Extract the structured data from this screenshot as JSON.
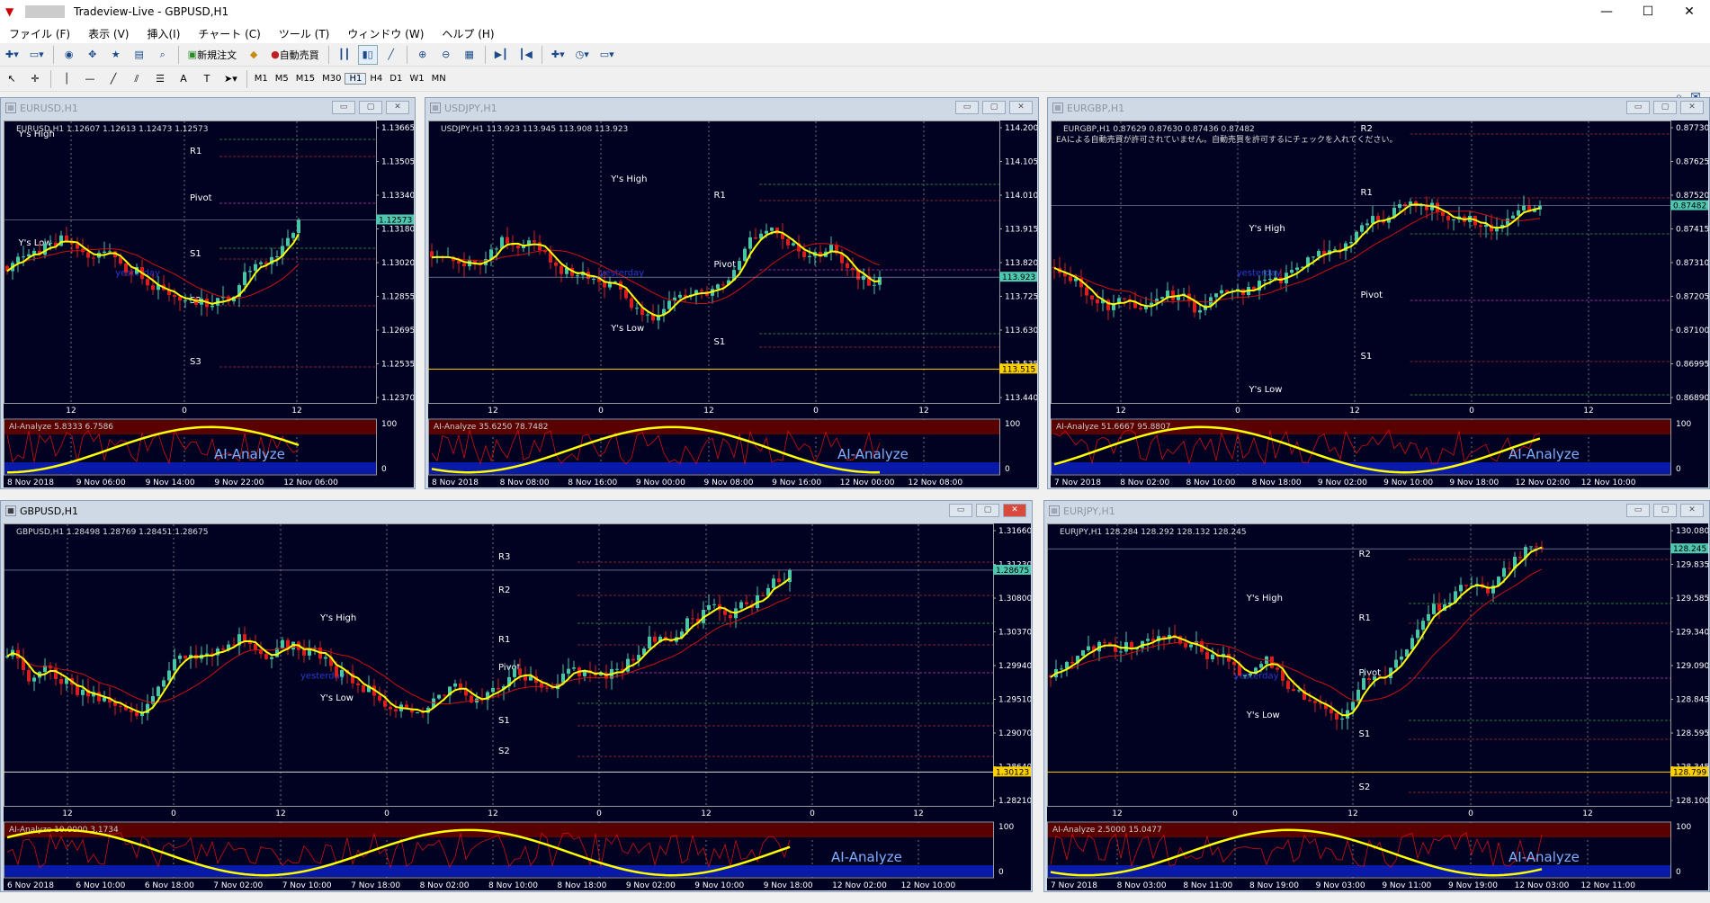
{
  "app": {
    "title": "Tradeview-Live - GBPUSD,H1",
    "controls": [
      "—",
      "☐",
      "✕"
    ]
  },
  "menu": [
    "ファイル (F)",
    "表示 (V)",
    "挿入(I)",
    "チャート (C)",
    "ツール (T)",
    "ウィンドウ (W)",
    "ヘルプ (H)"
  ],
  "toolbar": {
    "new_order": "新規注文",
    "auto_trade": "自動売買"
  },
  "timeframes": [
    "M1",
    "M5",
    "M15",
    "M30",
    "H1",
    "H4",
    "D1",
    "W1",
    "MN"
  ],
  "active_timeframe": "H1",
  "colors": {
    "chart_bg": "#010221",
    "candle_up": "#49c5a6",
    "candle_down": "#d62020",
    "ma_fast": "#ffff00",
    "ma_slow": "#d01010",
    "indicator_top": "#5b0000",
    "indicator_bottom": "#0a1aa8",
    "grid": "#4a5a7a"
  },
  "windows": [
    {
      "id": "eurusd",
      "title": "EURUSD,H1",
      "header": "EURUSD,H1  1.12607 1.12613 1.12473 1.12573",
      "prices": [
        "1.13665",
        "1.13505",
        "1.13340",
        "1.13180",
        "1.13020",
        "1.12855",
        "1.12695",
        "1.12535",
        "1.12370"
      ],
      "current_price": "1.12573",
      "time_labels": [
        "12",
        "0",
        "12"
      ],
      "levels": [
        {
          "label": "R1",
          "kind": "R",
          "y": 0.12
        },
        {
          "label": "Pivot",
          "kind": "P",
          "y": 0.29
        },
        {
          "label": "S1",
          "kind": "S",
          "y": 0.49
        },
        {
          "label": "S2",
          "kind": "S",
          "y": 0.66
        },
        {
          "label": "S3",
          "kind": "S",
          "y": 0.88
        },
        {
          "label": "Y's High",
          "kind": "H",
          "y": 0.06
        },
        {
          "label": "Y's Low",
          "kind": "L",
          "y": 0.45
        }
      ],
      "yesterday": "yesterday",
      "ind_header": "AI-Analyze 5.8333 6.7586",
      "ind_scale": [
        "100",
        "0"
      ],
      "dates": [
        "8 Nov 2018",
        "9 Nov 06:00",
        "9 Nov 14:00",
        "9 Nov 22:00",
        "12 Nov 06:00"
      ],
      "ai_label": "AI-Analyze"
    },
    {
      "id": "usdjpy",
      "title": "USDJPY,H1",
      "header": "USDJPY,H1  113.923 113.945 113.908 113.923",
      "prices": [
        "114.200",
        "114.105",
        "114.010",
        "113.915",
        "113.820",
        "113.725",
        "113.630",
        "113.535",
        "113.440"
      ],
      "current_price": "113.923",
      "hline_price": "113.515",
      "time_labels": [
        "12",
        "0",
        "12",
        "0",
        "12"
      ],
      "levels": [
        {
          "label": "Y's High",
          "kind": "H",
          "y": 0.22
        },
        {
          "label": "R1",
          "kind": "R",
          "y": 0.28
        },
        {
          "label": "Pivot",
          "kind": "P",
          "y": 0.53
        },
        {
          "label": "Y's Low",
          "kind": "L",
          "y": 0.76
        },
        {
          "label": "S1",
          "kind": "S",
          "y": 0.81
        }
      ],
      "yesterday": "yesterday",
      "ind_header": "AI-Analyze 35.6250 78.7482",
      "ind_scale": [
        "100",
        "0"
      ],
      "dates": [
        "8 Nov 2018",
        "8 Nov 08:00",
        "8 Nov 16:00",
        "9 Nov 00:00",
        "9 Nov 08:00",
        "9 Nov 16:00",
        "12 Nov 00:00",
        "12 Nov 08:00"
      ],
      "ai_label": "AI-Analyze"
    },
    {
      "id": "eurgbp",
      "title": "EURGBP,H1",
      "header": "EURGBP,H1  0.87629 0.87630 0.87436 0.87482",
      "warning": "EAによる自動売買が許可されていません。自動売買を許可するにチェックを入れてください。",
      "prices": [
        "0.87730",
        "0.87625",
        "0.87520",
        "0.87415",
        "0.87310",
        "0.87205",
        "0.87100",
        "0.86995",
        "0.86890"
      ],
      "current_price": "0.87482",
      "time_labels": [
        "12",
        "0",
        "12",
        "0",
        "12"
      ],
      "levels": [
        {
          "label": "R2",
          "kind": "R",
          "y": 0.04
        },
        {
          "label": "R1",
          "kind": "R",
          "y": 0.27
        },
        {
          "label": "Y's High",
          "kind": "H",
          "y": 0.4
        },
        {
          "label": "Pivot",
          "kind": "P",
          "y": 0.64
        },
        {
          "label": "S1",
          "kind": "S",
          "y": 0.86
        },
        {
          "label": "Y's Low",
          "kind": "L",
          "y": 0.98
        }
      ],
      "yesterday": "yesterday",
      "ind_header": "AI-Analyze 51.6667 95.8807",
      "ind_scale": [
        "100",
        "0"
      ],
      "dates": [
        "7 Nov 2018",
        "8 Nov 02:00",
        "8 Nov 10:00",
        "8 Nov 18:00",
        "9 Nov 02:00",
        "9 Nov 10:00",
        "9 Nov 18:00",
        "12 Nov 02:00",
        "12 Nov 10:00"
      ],
      "ai_label": "AI-Analyze"
    },
    {
      "id": "gbpusd",
      "title": "GBPUSD,H1",
      "header": "GBPUSD,H1  1.28498 1.28769 1.28451 1.28675",
      "prices": [
        "1.31660",
        "1.31230",
        "1.30800",
        "1.30370",
        "1.29940",
        "1.29510",
        "1.29070",
        "1.28640",
        "1.28210"
      ],
      "current_price": "1.28675",
      "hline_price": "1.30123",
      "time_labels": [
        "12",
        "0",
        "12",
        "0",
        "12",
        "0",
        "12",
        "0",
        "12"
      ],
      "levels": [
        {
          "label": "R3",
          "kind": "R",
          "y": 0.13
        },
        {
          "label": "R2",
          "kind": "R",
          "y": 0.25
        },
        {
          "label": "R1",
          "kind": "R",
          "y": 0.43
        },
        {
          "label": "Y's High",
          "kind": "H",
          "y": 0.35
        },
        {
          "label": "Pivot",
          "kind": "P",
          "y": 0.53
        },
        {
          "label": "Y's Low",
          "kind": "L",
          "y": 0.64
        },
        {
          "label": "S1",
          "kind": "S",
          "y": 0.72
        },
        {
          "label": "S2",
          "kind": "S",
          "y": 0.83
        }
      ],
      "yesterday": "yesterday",
      "ind_header": "AI-Analyze 10.0000 3.1734",
      "ind_scale": [
        "100",
        "0"
      ],
      "dates": [
        "6 Nov 2018",
        "6 Nov 10:00",
        "6 Nov 18:00",
        "7 Nov 02:00",
        "7 Nov 10:00",
        "7 Nov 18:00",
        "8 Nov 02:00",
        "8 Nov 10:00",
        "8 Nov 18:00",
        "9 Nov 02:00",
        "9 Nov 10:00",
        "9 Nov 18:00",
        "12 Nov 02:00",
        "12 Nov 10:00"
      ],
      "ai_label": "AI-Analyze"
    },
    {
      "id": "eurjpy",
      "title": "EURJPY,H1",
      "header": "EURJPY,H1  128.284 128.292 128.132 128.245",
      "prices": [
        "130.080",
        "129.835",
        "129.585",
        "129.340",
        "129.090",
        "128.845",
        "128.595",
        "128.345",
        "128.100"
      ],
      "current_price": "128.245",
      "hline_price": "128.799",
      "time_labels": [
        "12",
        "0",
        "12",
        "0",
        "12"
      ],
      "levels": [
        {
          "label": "R2",
          "kind": "R",
          "y": 0.12
        },
        {
          "label": "R1",
          "kind": "R",
          "y": 0.35
        },
        {
          "label": "Y's High",
          "kind": "H",
          "y": 0.28
        },
        {
          "label": "Pivot",
          "kind": "P",
          "y": 0.55
        },
        {
          "label": "Y's Low",
          "kind": "L",
          "y": 0.7
        },
        {
          "label": "S1",
          "kind": "S",
          "y": 0.77
        },
        {
          "label": "S2",
          "kind": "S",
          "y": 0.96
        }
      ],
      "yesterday": "yesterday",
      "ind_header": "AI-Analyze 2.5000 15.0477",
      "ind_scale": [
        "100",
        "0"
      ],
      "dates": [
        "7 Nov 2018",
        "8 Nov 03:00",
        "8 Nov 11:00",
        "8 Nov 19:00",
        "9 Nov 03:00",
        "9 Nov 11:00",
        "9 Nov 19:00",
        "12 Nov 03:00",
        "12 Nov 11:00"
      ],
      "ai_label": "AI-Analyze"
    }
  ]
}
